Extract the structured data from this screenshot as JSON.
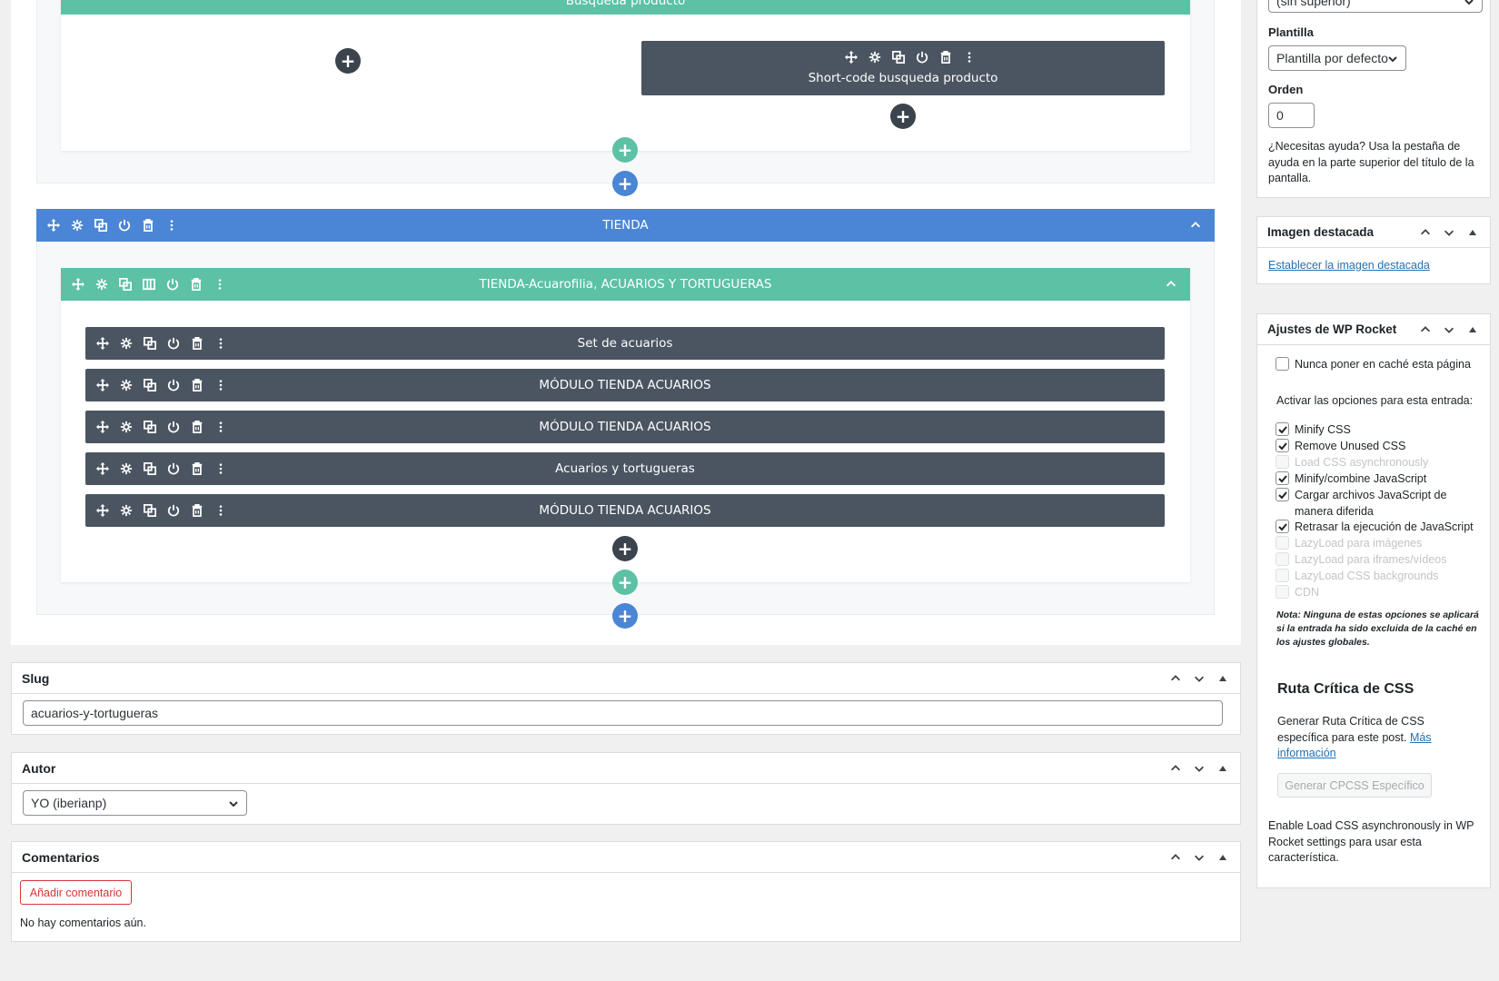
{
  "builder": {
    "top_row_title": "Busqueda producto",
    "shortcode_module": "Short-code busqueda producto",
    "section_title": "TIENDA",
    "row_title": "TIENDA-Acuarofilia, ACUARIOS Y TORTUGUERAS",
    "modules": [
      "Set de acuarios",
      "MÓDULO TIENDA ACUARIOS",
      "MÓDULO TIENDA ACUARIOS",
      "Acuarios y tortugueras",
      "MÓDULO TIENDA ACUARIOS"
    ],
    "add_symbol": "+"
  },
  "slug": {
    "title": "Slug",
    "value": "acuarios-y-tortugueras"
  },
  "autor": {
    "title": "Autor",
    "selected": "YO (iberianp)"
  },
  "comentarios": {
    "title": "Comentarios",
    "add_button": "Añadir comentario",
    "empty_text": "No hay comentarios aún."
  },
  "attributes": {
    "parent_selected": "(sin superior)",
    "plantilla_label": "Plantilla",
    "plantilla_selected": "Plantilla por defecto",
    "orden_label": "Orden",
    "orden_value": "0",
    "help_text": "¿Necesitas ayuda? Usa la pestaña de ayuda en la parte superior del título de la pantalla."
  },
  "featured_image": {
    "title": "Imagen destacada",
    "link": "Establecer la imagen destacada"
  },
  "wp_rocket": {
    "title": "Ajustes de WP Rocket",
    "never_cache": "Nunca poner en caché esta página",
    "activate_label": "Activar las opciones para esta entrada:",
    "options": [
      {
        "label": "Minify CSS",
        "checked": true,
        "disabled": false
      },
      {
        "label": "Remove Unused CSS",
        "checked": true,
        "disabled": false
      },
      {
        "label": "Load CSS asynchronously",
        "checked": false,
        "disabled": true
      },
      {
        "label": "Minify/combine JavaScript",
        "checked": true,
        "disabled": false
      },
      {
        "label": "Cargar archivos JavaScript de manera diferida",
        "checked": true,
        "disabled": false
      },
      {
        "label": "Retrasar la ejecución de JavaScript",
        "checked": true,
        "disabled": false
      },
      {
        "label": "LazyLoad para imágenes",
        "checked": false,
        "disabled": true
      },
      {
        "label": "LazyLoad para iframes/vídeos",
        "checked": false,
        "disabled": true
      },
      {
        "label": "LazyLoad CSS backgrounds",
        "checked": false,
        "disabled": true
      },
      {
        "label": "CDN",
        "checked": false,
        "disabled": true
      }
    ],
    "note": "Nota: Ninguna de estas opciones se aplicará si la entrada ha sido excluida de la caché en los ajustes globales.",
    "cpcss_title": "Ruta Crítica de CSS",
    "cpcss_text": "Generar Ruta Crítica de CSS específica para este post.",
    "cpcss_link": "Más información",
    "cpcss_button": "Generar CPCSS Específico",
    "async_text": "Enable Load CSS asynchronously in WP Rocket settings para usar esta característica."
  }
}
